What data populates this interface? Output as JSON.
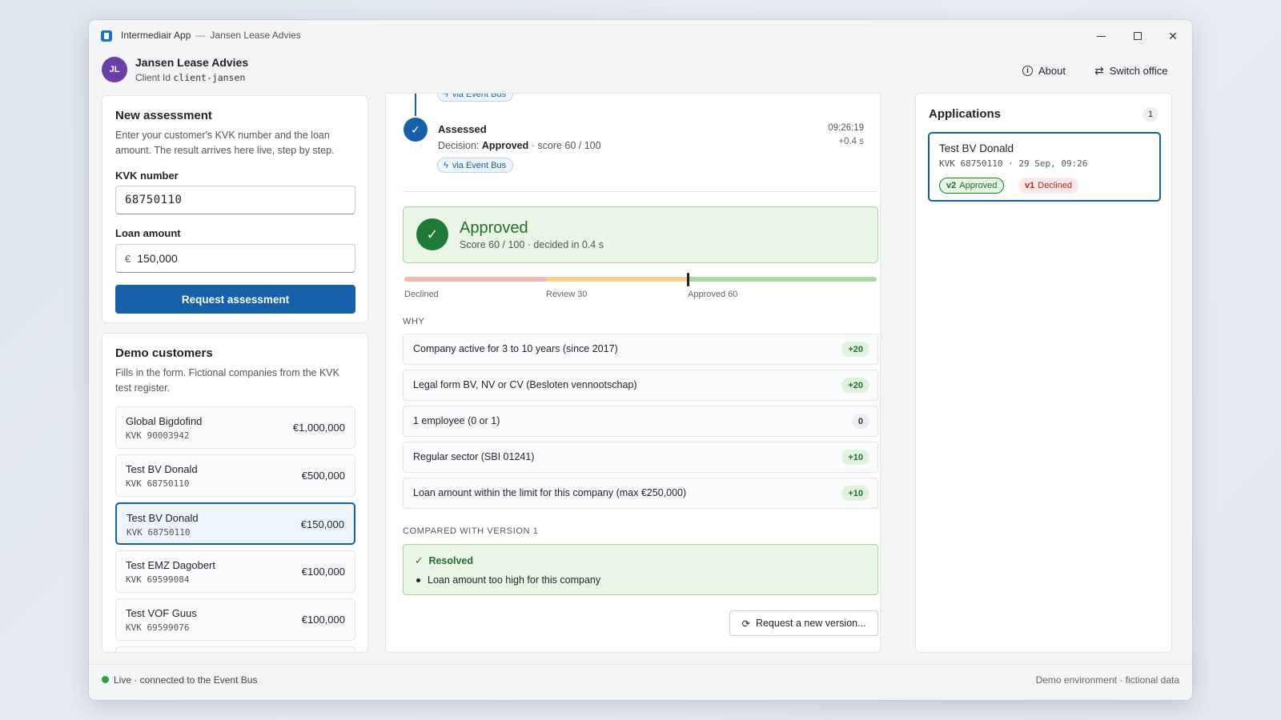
{
  "window": {
    "app_name": "Intermediair App",
    "separator": "—",
    "office_name": "Jansen Lease Advies"
  },
  "header": {
    "avatar_initials": "JL",
    "office_name": "Jansen Lease Advies",
    "client_id_label": "Client Id",
    "client_id_value": "client-jansen",
    "about_label": "About",
    "switch_office_label": "Switch office"
  },
  "new_assessment": {
    "title": "New assessment",
    "description": "Enter your customer's KVK number and the loan amount. The result arrives here live, step by step.",
    "kvk_label": "KVK number",
    "kvk_value": "68750110",
    "amount_label": "Loan amount",
    "currency_symbol": "€",
    "amount_value": "150,000",
    "submit_label": "Request assessment"
  },
  "demo_customers": {
    "title": "Demo customers",
    "description": "Fills in the form. Fictional companies from the KVK test register.",
    "items": [
      {
        "name": "Global Bigdofind",
        "kvk": "KVK 90003942",
        "amount": "€1,000,000",
        "selected": false
      },
      {
        "name": "Test BV Donald",
        "kvk": "KVK 68750110",
        "amount": "€500,000",
        "selected": false
      },
      {
        "name": "Test BV Donald",
        "kvk": "KVK 68750110",
        "amount": "€150,000",
        "selected": true
      },
      {
        "name": "Test EMZ Dagobert",
        "kvk": "KVK 69599084",
        "amount": "€100,000",
        "selected": false
      },
      {
        "name": "Test VOF Guus",
        "kvk": "KVK 69599076",
        "amount": "€100,000",
        "selected": false
      }
    ]
  },
  "timeline": {
    "chip_label": "via Event Bus",
    "step_title": "Assessed",
    "step_desc_prefix": "Decision:",
    "step_decision": "Approved",
    "step_score": "· score 60 / 100",
    "step_time": "09:26:19",
    "step_delta": "+0.4 s"
  },
  "result": {
    "title": "Approved",
    "subtitle": "Score 60 / 100 · decided in 0.4 s",
    "score": 60,
    "score_max": 100,
    "scale_labels": {
      "declined": "Declined",
      "review": "Review 30",
      "approved": "Approved 60"
    },
    "colors": {
      "approved": "#1e7a34",
      "declined": "#b3261e",
      "accent": "#1560a8"
    }
  },
  "why": {
    "title": "WHY",
    "reasons": [
      {
        "text": "Company active for 3 to 10 years (since 2017)",
        "points": "+20"
      },
      {
        "text": "Legal form BV, NV or CV (Besloten vennootschap)",
        "points": "+20"
      },
      {
        "text": "1 employee (0 or 1)",
        "points": "0"
      },
      {
        "text": "Regular sector (SBI 01241)",
        "points": "+10"
      },
      {
        "text": "Loan amount within the limit for this company (max €250,000)",
        "points": "+10"
      }
    ]
  },
  "comparison": {
    "title": "COMPARED WITH VERSION 1",
    "status": "Resolved",
    "items": [
      "Loan amount too high for this company"
    ]
  },
  "new_version_label": "Request a new version...",
  "applications": {
    "title": "Applications",
    "count": "1",
    "card": {
      "name": "Test BV Donald",
      "meta": "KVK 68750110 · 29 Sep, 09:26",
      "badges": [
        {
          "version": "v2",
          "label": "Approved"
        },
        {
          "version": "v1",
          "label": "Declined"
        }
      ]
    }
  },
  "statusbar": {
    "live_text": "Live · connected to the Event Bus",
    "right_text": "Demo environment · fictional data"
  }
}
